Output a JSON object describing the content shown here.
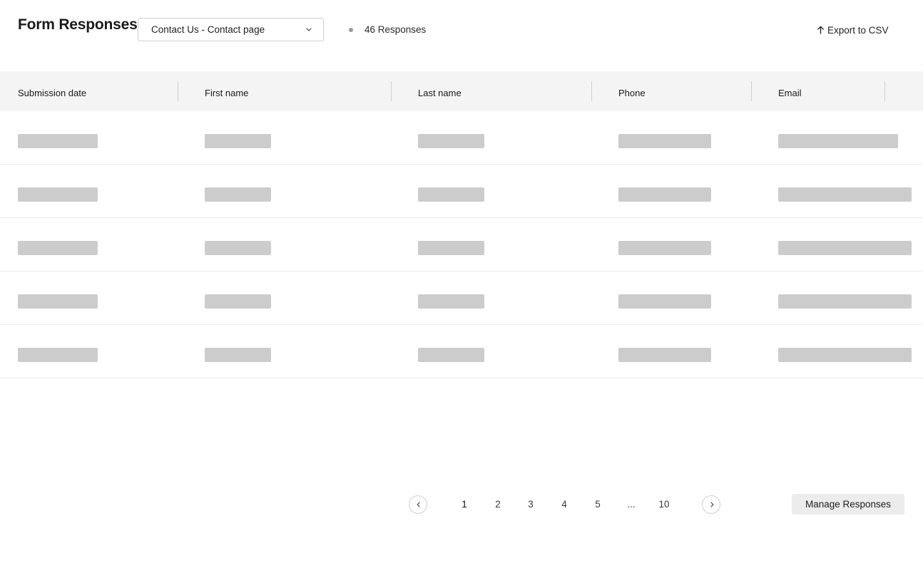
{
  "header": {
    "title": "Form Responses",
    "form_select": {
      "value": "Contact Us - Contact page"
    },
    "response_count": "46 Responses",
    "export_label": "Export to CSV"
  },
  "table": {
    "columns": [
      "Submission date",
      "First name",
      "Last name",
      "Phone",
      "Email"
    ],
    "rows_state": "loading"
  },
  "pagination": {
    "pages": [
      "1",
      "2",
      "3",
      "4",
      "5",
      "10"
    ],
    "ellipsis": "...",
    "current_page": "1"
  },
  "actions": {
    "manage_label": "Manage Responses"
  },
  "colors": {
    "header_bg": "#f4f4f4",
    "skeleton": "#cccccc",
    "button_bg": "#ececec"
  },
  "icons": {
    "dropdown": "chevron-down-icon",
    "export": "arrow-up-icon",
    "prev": "chevron-left-icon",
    "next": "chevron-right-icon",
    "status": "status-dot-icon"
  }
}
